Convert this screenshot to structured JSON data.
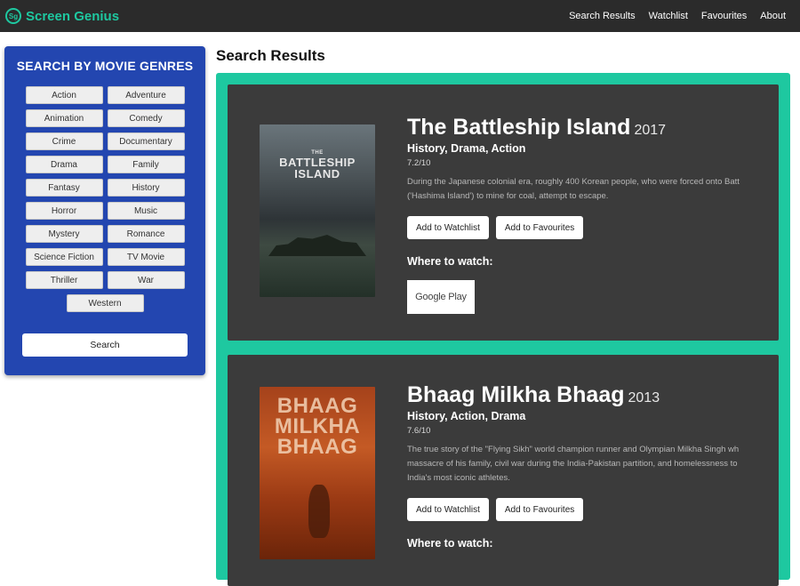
{
  "nav": {
    "logo_text": "Sg",
    "brand": "Screen Genius",
    "links": [
      "Search Results",
      "Watchlist",
      "Favourites",
      "About"
    ]
  },
  "sidebar": {
    "title": "SEARCH BY MOVIE GENRES",
    "genres": [
      "Action",
      "Adventure",
      "Animation",
      "Comedy",
      "Crime",
      "Documentary",
      "Drama",
      "Family",
      "Fantasy",
      "History",
      "Horror",
      "Music",
      "Mystery",
      "Romance",
      "Science Fiction",
      "TV Movie",
      "Thriller",
      "War",
      "Western"
    ],
    "search_label": "Search"
  },
  "main": {
    "heading": "Search Results",
    "movies": [
      {
        "title": "The Battleship Island",
        "year": "2017",
        "genres": "History, Drama, Action",
        "rating": "7.2/10",
        "overview_lines": [
          "During the Japanese colonial era, roughly 400 Korean people, who were forced onto Batt",
          "('Hashima Island') to mine for coal, attempt to escape."
        ],
        "watchlist_label": "Add to Watchlist",
        "favourites_label": "Add to Favourites",
        "where_label": "Where to watch:",
        "provider": "Google Play",
        "poster_small": "THE",
        "poster_title": "BATTLESHIP ISLAND"
      },
      {
        "title": "Bhaag Milkha Bhaag",
        "year": "2013",
        "genres": "History, Action, Drama",
        "rating": "7.6/10",
        "overview_lines": [
          "The true story of the \"Flying Sikh\" world champion runner and Olympian Milkha Singh wh",
          "massacre of his family, civil war during the India-Pakistan partition, and homelessness to",
          "India's most iconic athletes."
        ],
        "watchlist_label": "Add to Watchlist",
        "favourites_label": "Add to Favourites",
        "where_label": "Where to watch:",
        "poster_title": "BHAAG MILKHA BHAAG"
      }
    ]
  },
  "colors": {
    "navbar": "#2b2b2b",
    "accent": "#1ec8a0",
    "sidebar": "#2346b0",
    "card": "#3b3b3b"
  }
}
